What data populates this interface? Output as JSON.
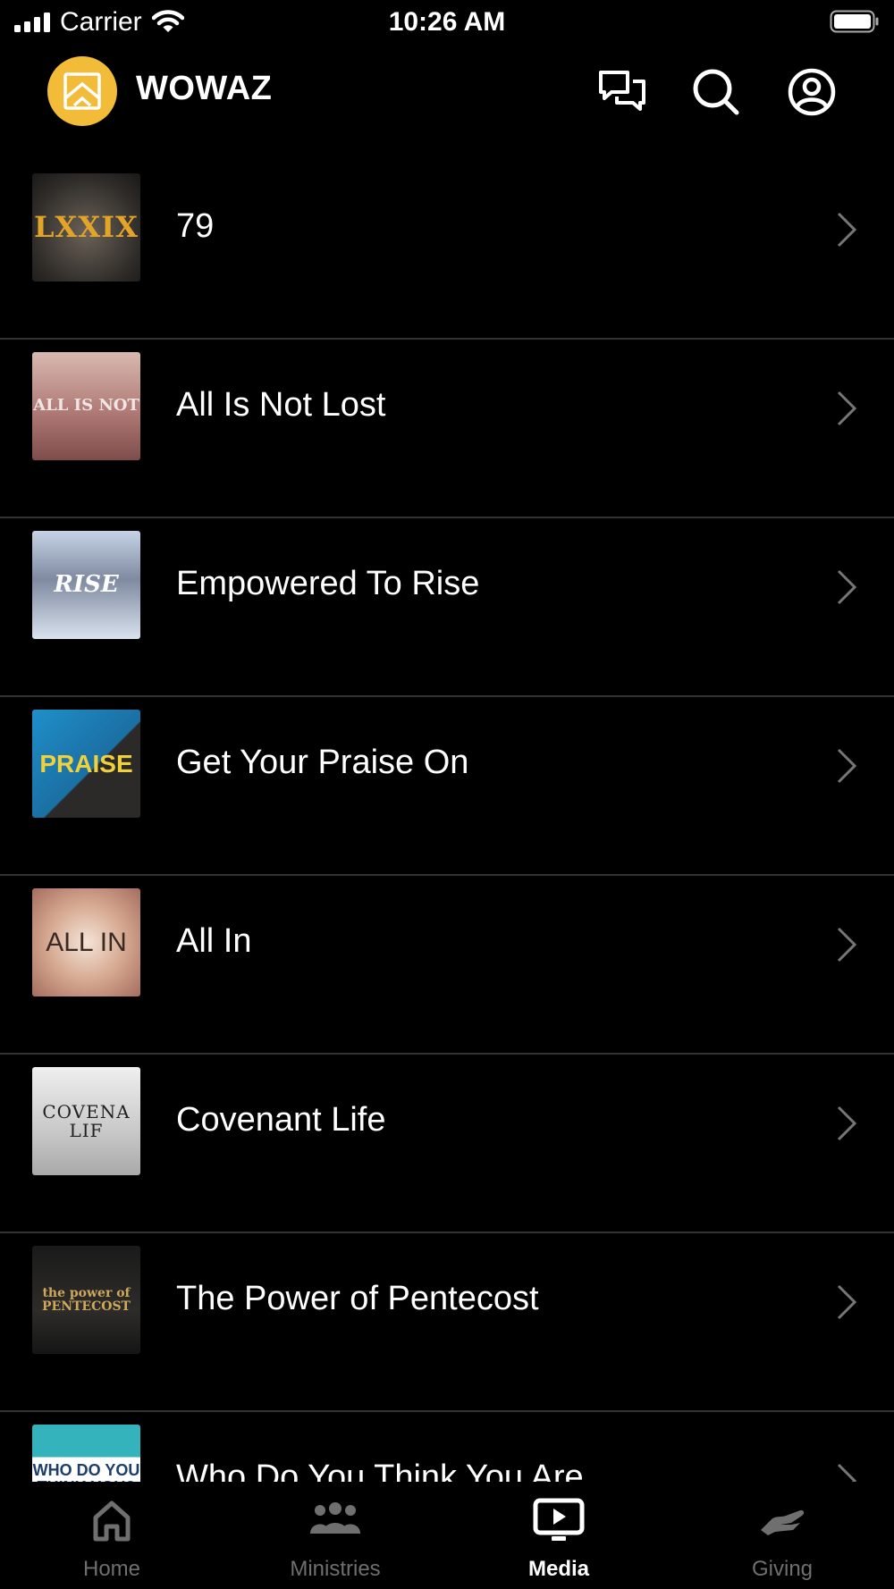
{
  "status_bar": {
    "carrier": "Carrier",
    "time": "10:26 AM"
  },
  "header": {
    "app_title": "WOWAZ",
    "logo_color": "#f2bb38",
    "icons": [
      "chat-icon",
      "search-icon",
      "profile-icon"
    ]
  },
  "media_list": {
    "items": [
      {
        "title": "79",
        "thumb_text": "LXXIX"
      },
      {
        "title": "All Is Not Lost",
        "thumb_text": "ALL IS NOT"
      },
      {
        "title": "Empowered To Rise",
        "thumb_text": "RISE"
      },
      {
        "title": "Get Your Praise On",
        "thumb_text": "PRAISE"
      },
      {
        "title": "All In",
        "thumb_text": "ALL IN"
      },
      {
        "title": "Covenant Life",
        "thumb_text": "COVENA LIF"
      },
      {
        "title": "The Power of Pentecost",
        "thumb_text": "the power of PENTECOST"
      },
      {
        "title": "Who Do You Think You Are",
        "thumb_text": "WHO DO YOU THINK YOU?"
      }
    ]
  },
  "tabbar": {
    "tabs": [
      {
        "label": "Home",
        "icon": "home-icon",
        "active": false
      },
      {
        "label": "Ministries",
        "icon": "people-icon",
        "active": false
      },
      {
        "label": "Media",
        "icon": "media-play-icon",
        "active": true
      },
      {
        "label": "Giving",
        "icon": "giving-hand-icon",
        "active": false
      }
    ]
  }
}
